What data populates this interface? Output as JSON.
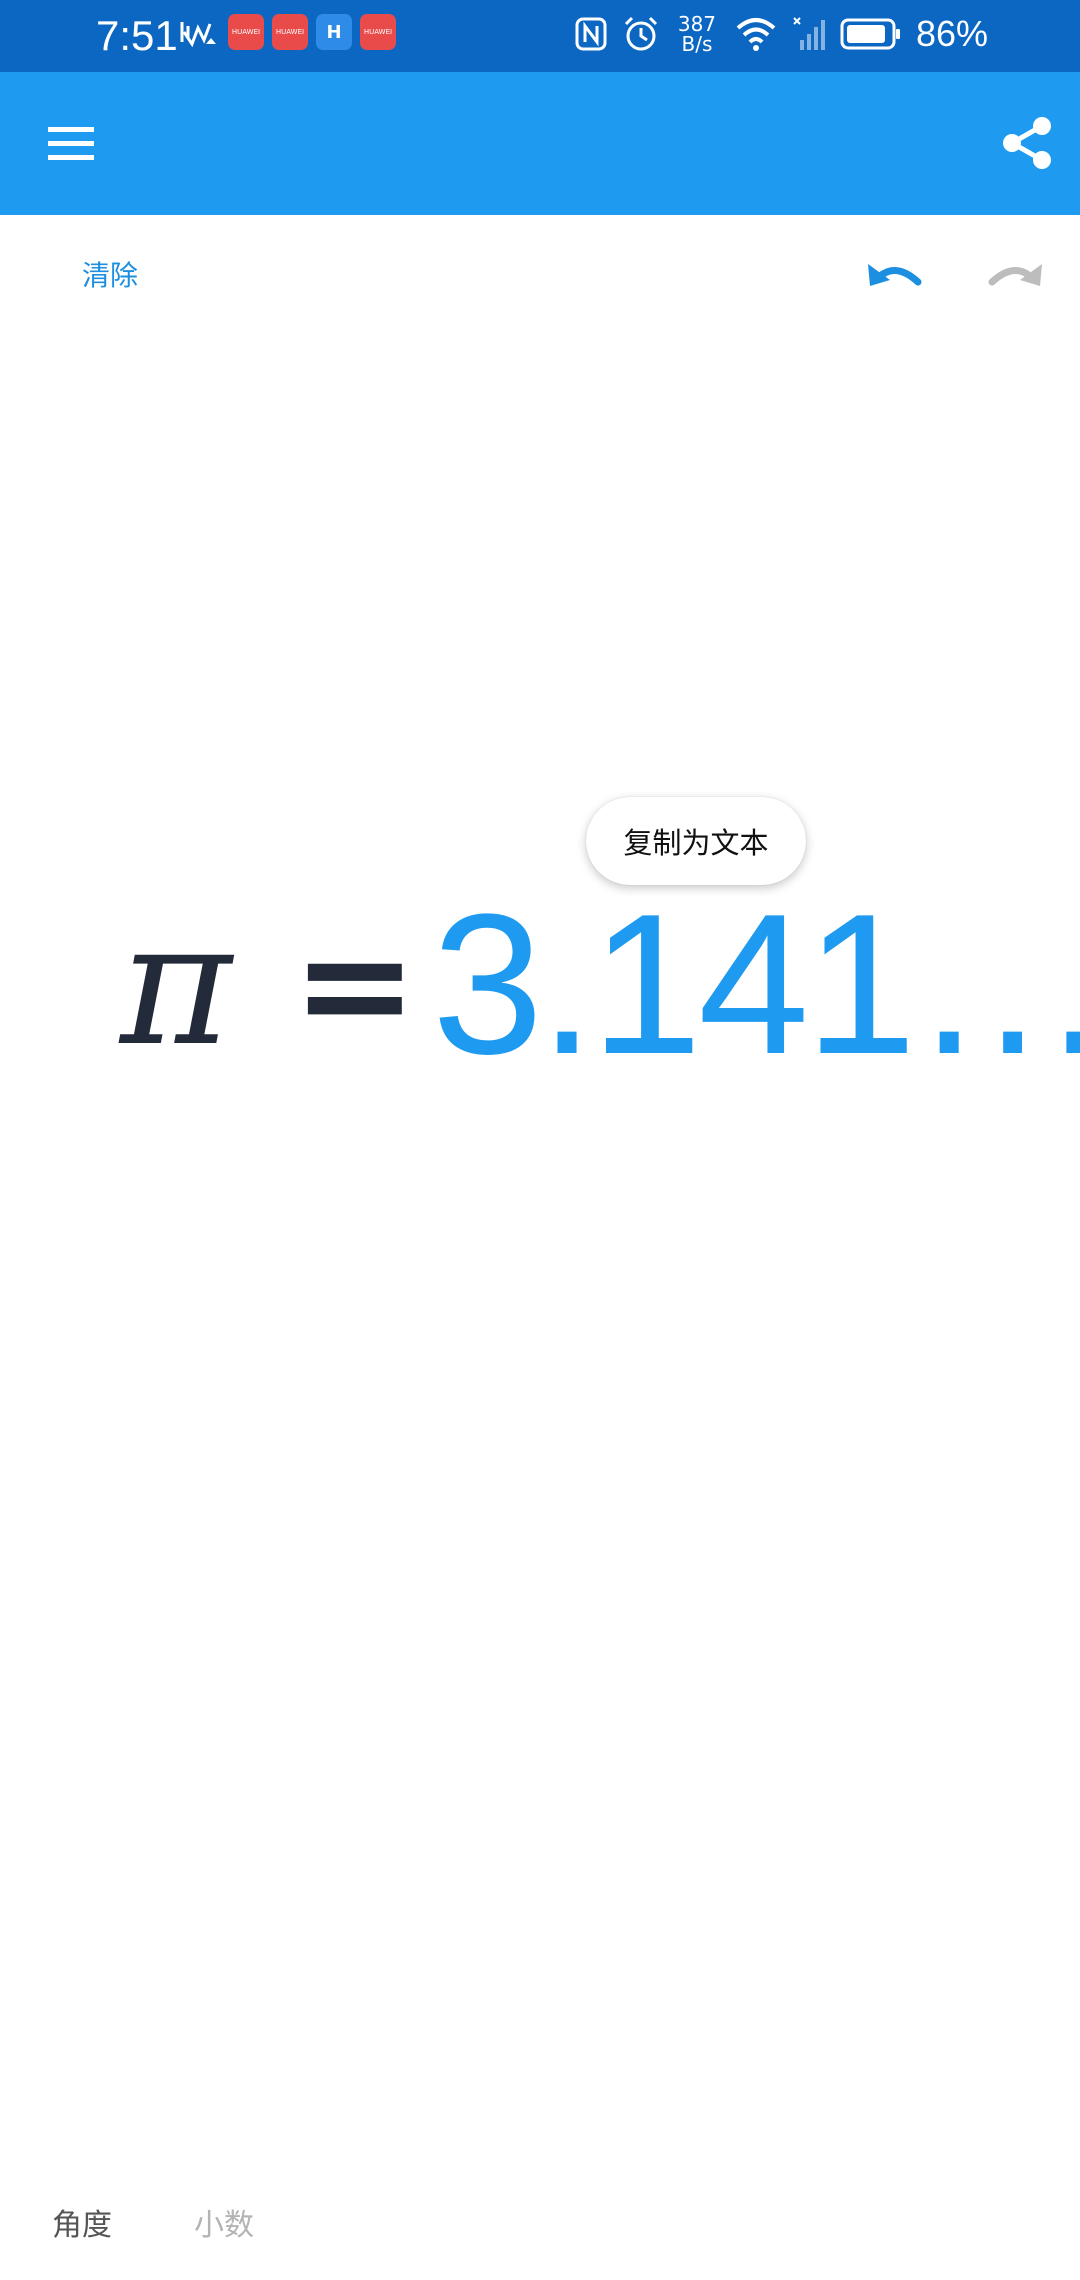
{
  "status_bar": {
    "time": "7:51",
    "notification_apps": [
      "HUAWEI",
      "HUAWEI",
      "H",
      "HUAWEI"
    ],
    "network_speed_value": "387",
    "network_speed_unit": "B/s",
    "battery_percent": "86%"
  },
  "app_bar": {
    "menu_icon": "menu-icon",
    "share_icon": "share-icon",
    "color": "#1e9af0"
  },
  "toolbar": {
    "clear_label": "清除",
    "undo_icon": "undo-icon",
    "redo_icon": "redo-icon"
  },
  "popup": {
    "copy_as_text": "复制为文本"
  },
  "expression": {
    "symbol": "π",
    "equals": "=",
    "result": "3.141…"
  },
  "modes": {
    "angle": "角度",
    "decimal": "小数"
  }
}
